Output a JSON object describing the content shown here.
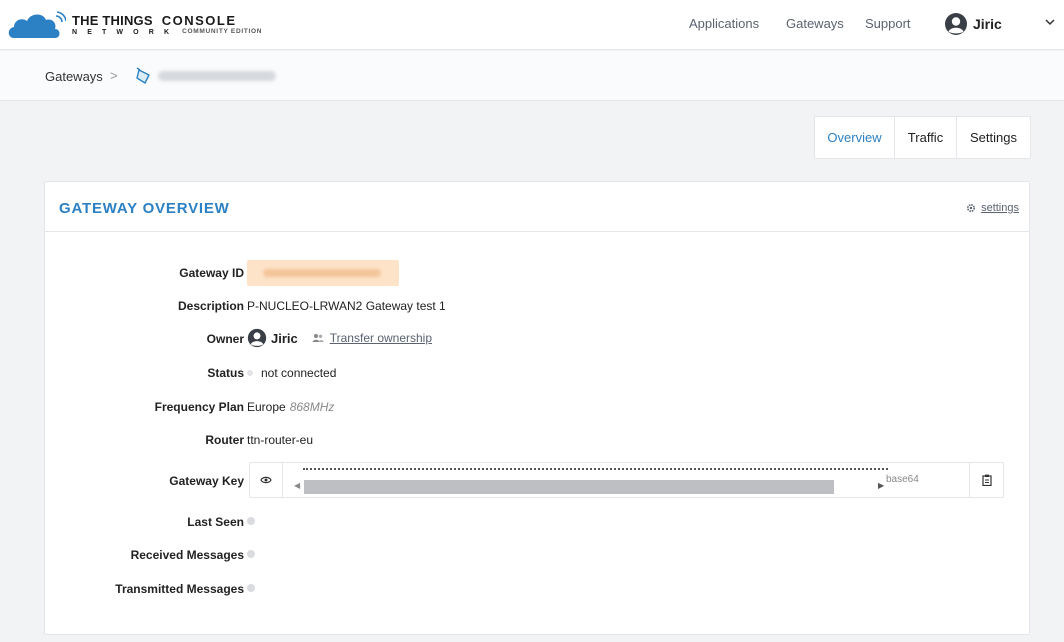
{
  "header": {
    "brand_main": "THE THINGS",
    "brand_sub": "N E T W O R K",
    "console": "CONSOLE",
    "edition": "COMMUNITY EDITION",
    "nav": [
      "Applications",
      "Gateways",
      "Support"
    ],
    "user": "Jiric"
  },
  "breadcrumb": {
    "root": "Gateways",
    "separator": ">"
  },
  "tabs": [
    {
      "label": "Overview",
      "active": true
    },
    {
      "label": "Traffic",
      "active": false
    },
    {
      "label": "Settings",
      "active": false
    }
  ],
  "card": {
    "title": "GATEWAY OVERVIEW",
    "settings_link": "settings"
  },
  "fields": {
    "gateway_id_label": "Gateway ID",
    "description_label": "Description",
    "description_value": "P-NUCLEO-LRWAN2 Gateway test 1",
    "owner_label": "Owner",
    "owner_value": "Jiric",
    "transfer_link": "Transfer ownership",
    "status_label": "Status",
    "status_value": "not connected",
    "frequency_label": "Frequency Plan",
    "frequency_value": "Europe",
    "frequency_mhz": "868MHz",
    "router_label": "Router",
    "router_value": "ttn-router-eu",
    "key_label": "Gateway Key",
    "key_encoding": "base64",
    "last_seen_label": "Last Seen",
    "received_label": "Received Messages",
    "transmitted_label": "Transmitted Messages"
  },
  "colors": {
    "accent": "#2c80c4",
    "id_highlight": "#fde3c8"
  }
}
